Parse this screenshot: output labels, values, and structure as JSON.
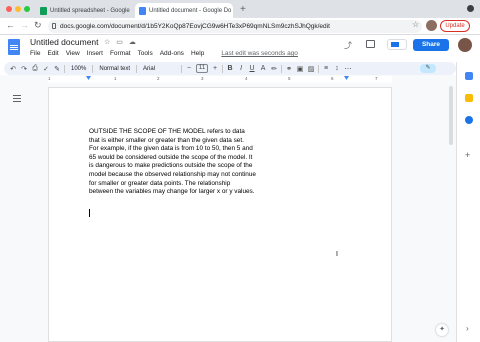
{
  "browser": {
    "tabs": [
      {
        "title": "Untitled spreadsheet - Google",
        "active": false,
        "favicon_color": "#0f9d58"
      },
      {
        "title": "Untitled document - Google Do",
        "active": true,
        "favicon_color": "#4285f4"
      }
    ],
    "close_glyph": "×",
    "new_tab_glyph": "+",
    "url": "docs.google.com/document/d/1b5Y2KoQp87EovjCG9w6HTe3xP69qmNLSm9czhSJhQgk/edit",
    "update_label": "Update"
  },
  "docs": {
    "title": "Untitled document",
    "menu": [
      "File",
      "Edit",
      "View",
      "Insert",
      "Format",
      "Tools",
      "Add-ons",
      "Help"
    ],
    "last_edit": "Last edit was seconds ago",
    "share_label": "Share"
  },
  "toolbar": {
    "zoom": "100%",
    "style": "Normal text",
    "font": "Arial",
    "font_size": "11",
    "bold": "B",
    "italic": "I",
    "underline": "U",
    "text_color": "A"
  },
  "ruler": {
    "ticks": [
      "1",
      "1",
      "2",
      "3",
      "4",
      "5",
      "6",
      "7"
    ]
  },
  "document": {
    "lines": [
      "OUTSIDE THE SCOPE OF THE MODEL refers to data",
      "that is either smaller or greater than the given data set.",
      "For example, if the given data is from 10 to 50, then 5 and",
      "65 would be considered outside the scope of the model.  It",
      "is dangerous to make predictions outside the scope of the",
      "model because the observed relationship may not continue",
      "for smaller or greater data points.  The relationship",
      "between the variables may change for larger x or y values."
    ]
  },
  "colors": {
    "accent": "#1a73e8",
    "update": "#d93025",
    "docs_blue": "#4285f4"
  }
}
